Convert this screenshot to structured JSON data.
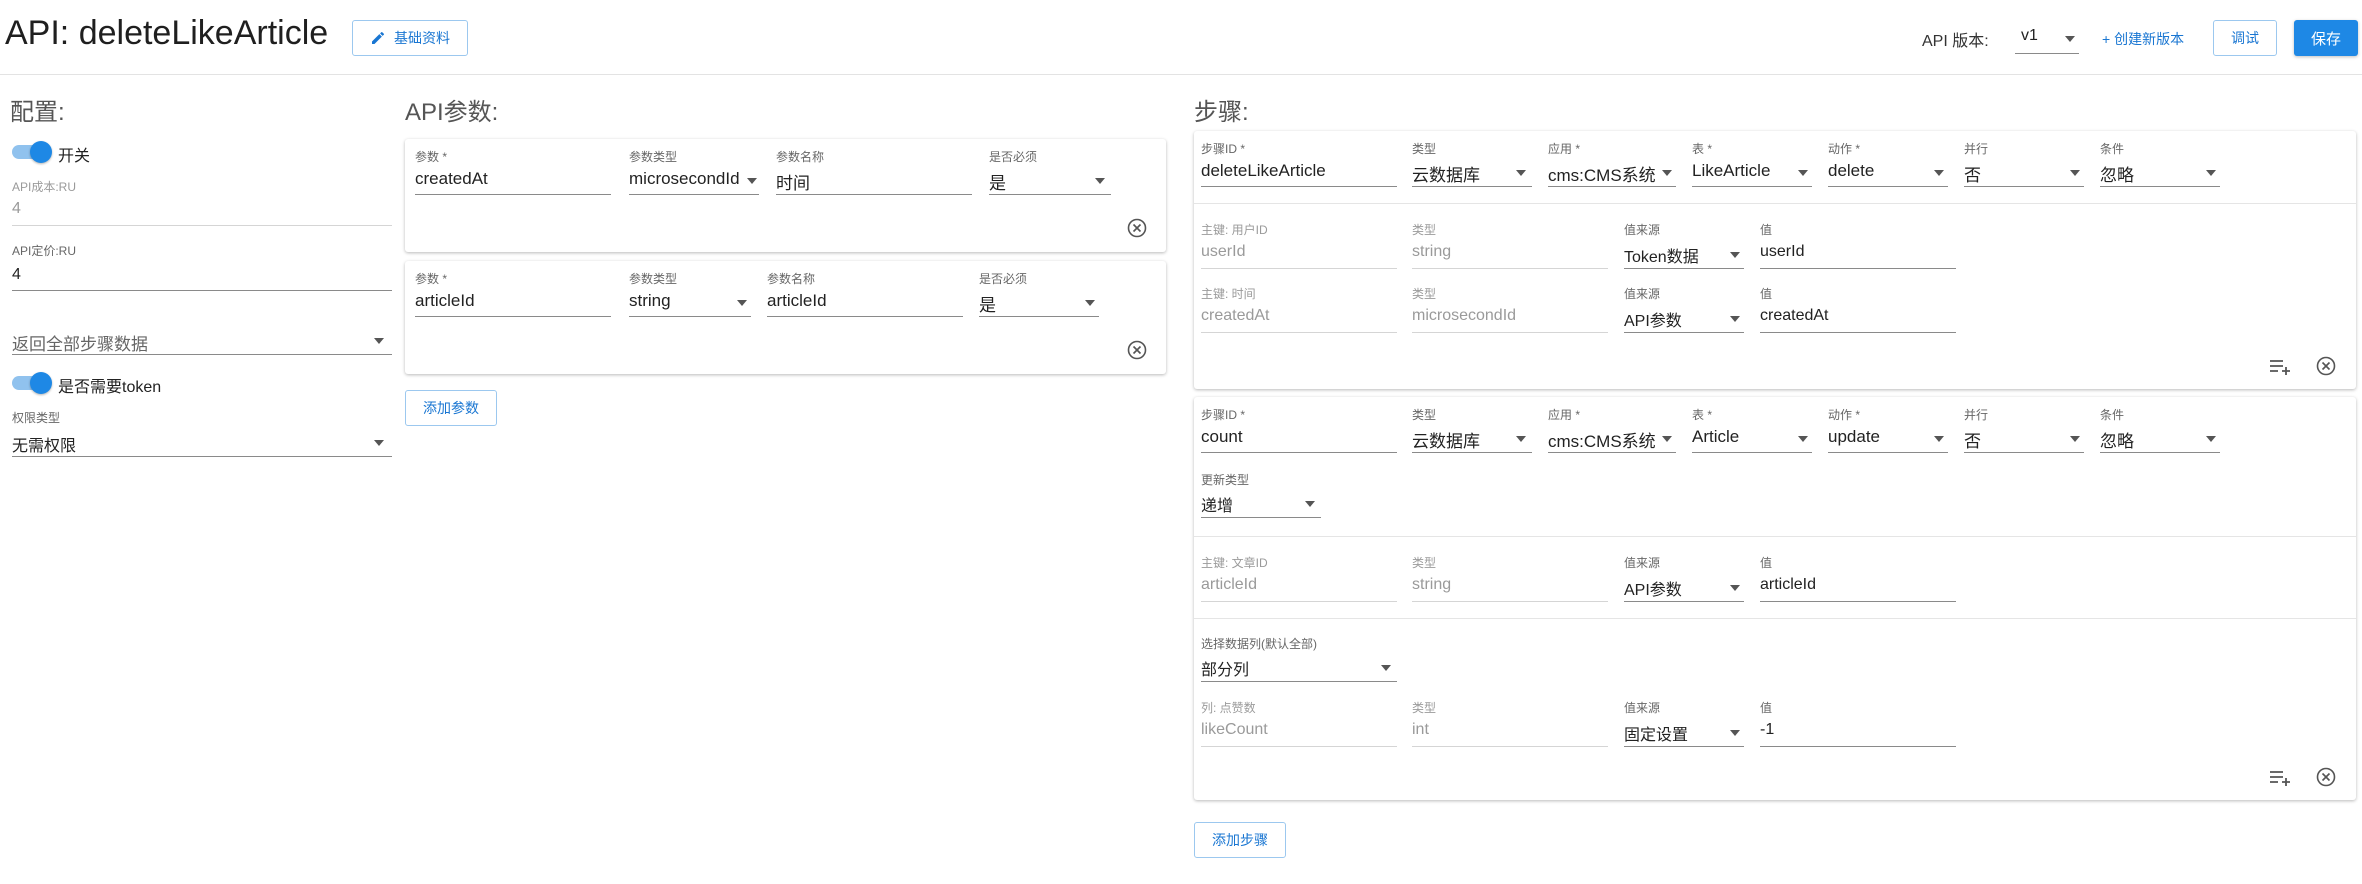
{
  "header": {
    "title": "API: deleteLikeArticle",
    "basic_info_label": "基础资料",
    "version_label": "API 版本:",
    "version_value": "v1",
    "create_version_label": "+ 创建新版本",
    "debug_label": "调试",
    "save_label": "保存"
  },
  "config": {
    "title": "配置:",
    "switch_label": "开关",
    "cost_label": "API成本:RU",
    "cost_value": "4",
    "price_label": "API定价:RU",
    "price_value": "4",
    "return_select": "返回全部步骤数据",
    "token_label": "是否需要token",
    "perm_label": "权限类型",
    "perm_value": "无需权限"
  },
  "params": {
    "title": "API参数:",
    "add_label": "添加参数",
    "labels": {
      "param": "参数 *",
      "type": "参数类型",
      "name": "参数名称",
      "required": "是否必须"
    },
    "items": [
      {
        "param": "createdAt",
        "type": "microsecondId",
        "name": "时间",
        "required": "是"
      },
      {
        "param": "articleId",
        "type": "string",
        "name": "articleId",
        "required": "是"
      }
    ]
  },
  "steps": {
    "title": "步骤:",
    "add_label": "添加步骤",
    "labels": {
      "id": "步骤ID *",
      "type": "类型",
      "app": "应用 *",
      "table": "表 *",
      "action": "动作 *",
      "parallel": "并行",
      "condition": "条件",
      "type2": "类型",
      "source": "值来源",
      "value": "值",
      "update_type": "更新类型",
      "select_cols": "选择数据列(默认全部)"
    },
    "step1": {
      "id": "deleteLikeArticle",
      "type": "云数据库",
      "app": "cms:CMS系统",
      "table": "LikeArticle",
      "action": "delete",
      "parallel": "否",
      "condition": "忽略",
      "keys": [
        {
          "label": "主键: 用户ID",
          "field": "userId",
          "type": "string",
          "source": "Token数据",
          "value": "userId"
        },
        {
          "label": "主键: 时间",
          "field": "createdAt",
          "type": "microsecondId",
          "source": "API参数",
          "value": "createdAt"
        }
      ]
    },
    "step2": {
      "id": "count",
      "type": "云数据库",
      "app": "cms:CMS系统",
      "table": "Article",
      "action": "update",
      "parallel": "否",
      "condition": "忽略",
      "update_type": "递增",
      "key": {
        "label": "主键: 文章ID",
        "field": "articleId",
        "type": "string",
        "source": "API参数",
        "value": "articleId"
      },
      "select_cols": "部分列",
      "col": {
        "label": "列: 点赞数",
        "field": "likeCount",
        "type": "int",
        "source": "固定设置",
        "value": "-1"
      }
    }
  },
  "colors": {
    "accent": "#1e88e5",
    "accent_light": "#90c2ee"
  }
}
